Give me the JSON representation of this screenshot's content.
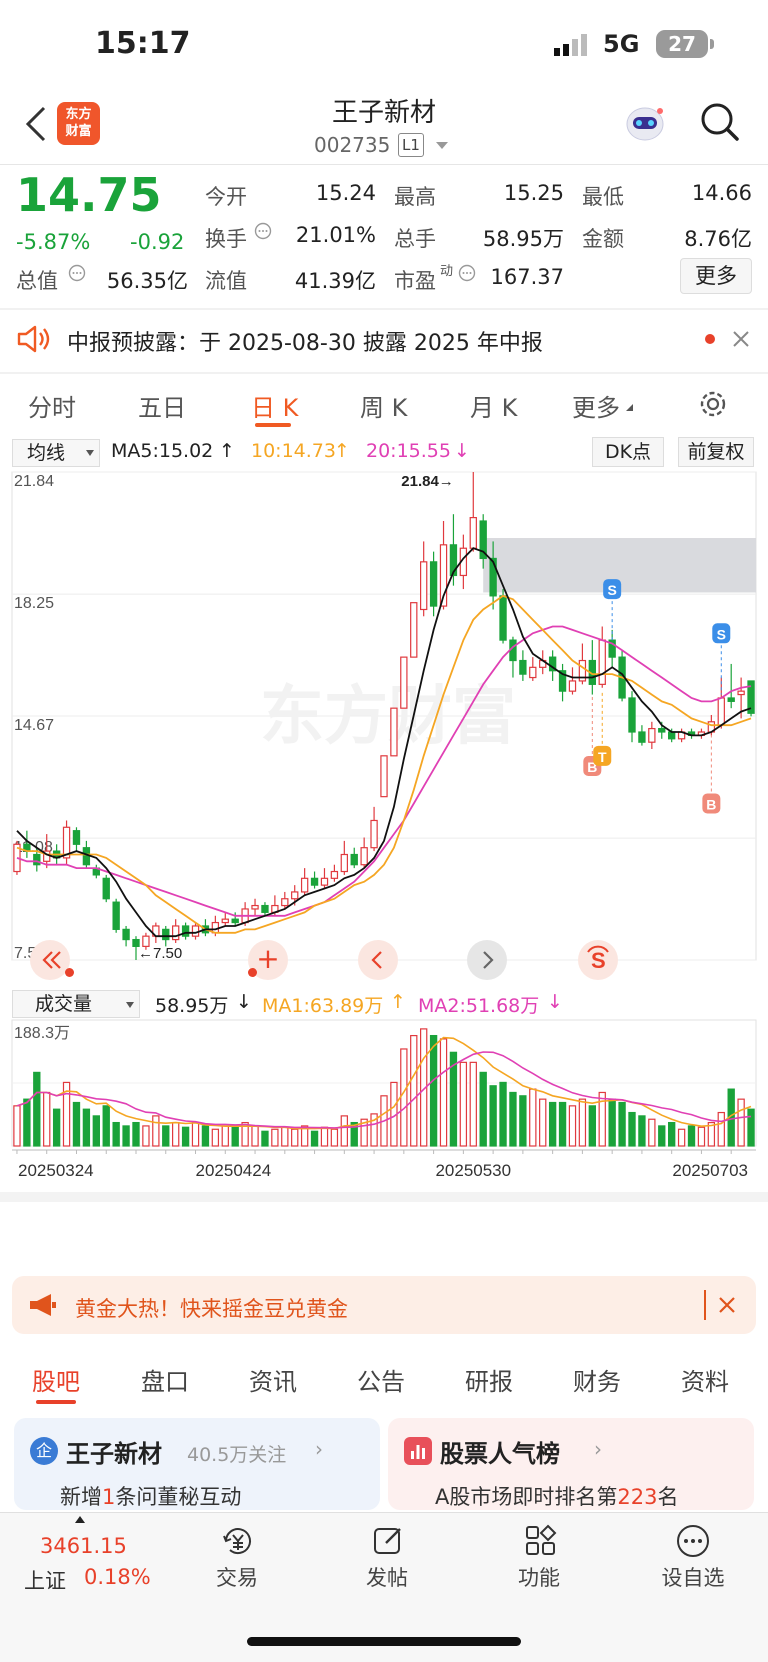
{
  "status_bar": {
    "time": "15:17",
    "network": "5G",
    "battery": "27"
  },
  "header": {
    "back_icon": "chevron-left-icon",
    "app_logo_text": "东方\n财富",
    "title": "王子新材",
    "code": "002735",
    "level_badge": "L1"
  },
  "quote": {
    "price": "14.75",
    "change_pct": "-5.87%",
    "change": "-0.92",
    "fields": [
      {
        "label": "今开",
        "value": "15.24"
      },
      {
        "label": "最高",
        "value": "15.25"
      },
      {
        "label": "最低",
        "value": "14.66"
      },
      {
        "label": "换手",
        "value": "21.01%"
      },
      {
        "label": "总手",
        "value": "58.95万"
      },
      {
        "label": "金额",
        "value": "8.76亿"
      },
      {
        "label": "总值",
        "value": "56.35亿"
      },
      {
        "label": "流值",
        "value": "41.39亿"
      },
      {
        "label": "市盈",
        "value": "167.37"
      }
    ],
    "pe_superscript": "动",
    "more_button": "更多"
  },
  "notice": {
    "text": "中报预披露：于 2025-08-30 披露 2025 年中报"
  },
  "period_tabs": [
    "分时",
    "五日",
    "日 K",
    "周 K",
    "月 K",
    "更多"
  ],
  "period_active_index": 2,
  "ma_bar": {
    "select_label": "均线",
    "ma5": "MA5:15.02",
    "ma10": "10:14.73",
    "ma20": "20:15.55",
    "dk_button": "DK点",
    "adjust_button": "前复权"
  },
  "chart_controls": {
    "zoom_in": "+"
  },
  "volume_bar": {
    "select_label": "成交量",
    "vol": "58.95万",
    "ma1": "MA1:63.89万",
    "ma2": "MA2:51.68万"
  },
  "colors": {
    "up": "#e0393e",
    "down": "#1aa33a",
    "ma5": "#111111",
    "ma10": "#f5a623",
    "ma20": "#e040b4",
    "accent": "#f05a23"
  },
  "chart_data": {
    "type": "candlestick",
    "y_ticks": [
      "21.84",
      "18.25",
      "14.67",
      "11.08",
      "7.50"
    ],
    "ylim": [
      7.5,
      21.84
    ],
    "annotations": {
      "max": "21.84",
      "min": "7.50",
      "signals": [
        "S",
        "S",
        "B",
        "T",
        "B"
      ]
    },
    "watermark": "东方财富",
    "x_ticks": [
      "20250324",
      "20250424",
      "20250530",
      "20250703"
    ],
    "volume_max_label": "188.3万",
    "candles": [
      [
        10.1,
        10.9,
        11.0,
        10.0
      ],
      [
        10.9,
        10.7,
        11.3,
        10.5
      ],
      [
        10.6,
        10.3,
        10.8,
        10.1
      ],
      [
        10.4,
        10.7,
        11.2,
        10.2
      ],
      [
        10.7,
        10.5,
        10.9,
        10.3
      ],
      [
        10.5,
        11.4,
        11.6,
        10.3
      ],
      [
        11.3,
        10.9,
        11.4,
        10.7
      ],
      [
        10.8,
        10.3,
        11.0,
        10.2
      ],
      [
        10.2,
        10.0,
        10.3,
        9.9
      ],
      [
        9.9,
        9.3,
        10.0,
        9.2
      ],
      [
        9.2,
        8.4,
        9.3,
        8.3
      ],
      [
        8.4,
        8.1,
        8.5,
        7.9
      ],
      [
        8.1,
        7.9,
        8.2,
        7.5
      ],
      [
        7.9,
        8.2,
        8.3,
        7.8
      ],
      [
        8.2,
        8.5,
        8.6,
        8.0
      ],
      [
        8.4,
        8.1,
        8.5,
        7.9
      ],
      [
        8.1,
        8.5,
        8.7,
        8.0
      ],
      [
        8.5,
        8.2,
        8.6,
        8.1
      ],
      [
        8.2,
        8.5,
        8.6,
        8.1
      ],
      [
        8.5,
        8.3,
        8.7,
        8.2
      ],
      [
        8.3,
        8.6,
        8.8,
        8.2
      ],
      [
        8.6,
        8.7,
        8.9,
        8.5
      ],
      [
        8.7,
        8.6,
        8.9,
        8.5
      ],
      [
        8.6,
        9.0,
        9.2,
        8.5
      ],
      [
        9.0,
        9.1,
        9.3,
        8.8
      ],
      [
        9.1,
        8.9,
        9.2,
        8.8
      ],
      [
        8.9,
        9.1,
        9.4,
        8.8
      ],
      [
        9.1,
        9.3,
        9.5,
        9.0
      ],
      [
        9.3,
        9.5,
        9.7,
        9.1
      ],
      [
        9.5,
        9.9,
        10.2,
        9.4
      ],
      [
        9.9,
        9.7,
        10.1,
        9.6
      ],
      [
        9.7,
        9.9,
        10.2,
        9.6
      ],
      [
        9.9,
        10.1,
        10.3,
        9.8
      ],
      [
        10.1,
        10.6,
        11.0,
        10.0
      ],
      [
        10.6,
        10.3,
        10.8,
        10.2
      ],
      [
        10.3,
        10.8,
        11.1,
        10.2
      ],
      [
        10.8,
        11.6,
        12.0,
        10.7
      ],
      [
        12.3,
        13.5,
        13.5,
        12.3
      ],
      [
        13.5,
        14.9,
        14.9,
        13.5
      ],
      [
        14.9,
        16.4,
        16.4,
        14.9
      ],
      [
        16.4,
        18.0,
        18.0,
        16.4
      ],
      [
        17.8,
        19.2,
        19.8,
        17.6
      ],
      [
        19.2,
        17.9,
        19.5,
        17.6
      ],
      [
        17.9,
        19.7,
        20.4,
        17.8
      ],
      [
        19.7,
        18.8,
        20.6,
        18.5
      ],
      [
        18.8,
        19.6,
        20.0,
        18.4
      ],
      [
        19.6,
        20.5,
        21.84,
        19.5
      ],
      [
        20.4,
        19.3,
        20.6,
        19.0
      ],
      [
        19.3,
        18.2,
        19.8,
        17.8
      ],
      [
        18.2,
        16.9,
        18.4,
        16.8
      ],
      [
        16.9,
        16.3,
        17.0,
        15.8
      ],
      [
        16.3,
        15.9,
        16.6,
        15.7
      ],
      [
        15.8,
        16.1,
        16.4,
        15.7
      ],
      [
        16.1,
        16.3,
        16.6,
        15.9
      ],
      [
        16.4,
        16.0,
        16.6,
        15.7
      ],
      [
        16.0,
        15.4,
        16.2,
        15.1
      ],
      [
        15.4,
        15.7,
        16.1,
        15.3
      ],
      [
        15.7,
        16.3,
        16.8,
        15.6
      ],
      [
        16.3,
        15.6,
        16.9,
        15.3
      ],
      [
        15.6,
        16.9,
        17.3,
        15.5
      ],
      [
        16.9,
        16.4,
        17.2,
        16.1
      ],
      [
        16.4,
        15.2,
        16.6,
        15.1
      ],
      [
        15.2,
        14.2,
        15.4,
        13.9
      ],
      [
        14.2,
        13.9,
        14.4,
        13.8
      ],
      [
        13.9,
        14.3,
        14.5,
        13.7
      ],
      [
        14.3,
        14.2,
        14.5,
        14.0
      ],
      [
        14.2,
        14.0,
        14.3,
        13.9
      ],
      [
        14.0,
        14.2,
        14.3,
        13.9
      ],
      [
        14.2,
        14.1,
        14.3,
        14.0
      ],
      [
        14.1,
        14.2,
        14.3,
        14.0
      ],
      [
        14.2,
        14.5,
        14.7,
        14.1
      ],
      [
        14.4,
        15.2,
        15.8,
        14.3
      ],
      [
        15.2,
        15.1,
        16.2,
        14.9
      ],
      [
        15.3,
        15.4,
        15.8,
        14.6
      ],
      [
        15.7,
        14.75,
        15.25,
        14.66
      ]
    ],
    "volumes": [
      60,
      70,
      110,
      80,
      55,
      95,
      65,
      55,
      45,
      60,
      35,
      30,
      35,
      30,
      45,
      30,
      35,
      28,
      35,
      30,
      25,
      30,
      28,
      35,
      30,
      22,
      25,
      28,
      25,
      30,
      22,
      28,
      25,
      45,
      35,
      40,
      48,
      75,
      95,
      145,
      165,
      175,
      165,
      160,
      140,
      125,
      125,
      110,
      90,
      95,
      80,
      75,
      85,
      70,
      65,
      65,
      60,
      70,
      60,
      80,
      70,
      65,
      50,
      45,
      40,
      30,
      35,
      25,
      30,
      28,
      35,
      50,
      85,
      70,
      55
    ],
    "ma5": [
      11.3,
      11.0,
      10.8,
      10.6,
      10.5,
      10.6,
      10.7,
      10.6,
      10.5,
      10.2,
      9.8,
      9.3,
      8.9,
      8.5,
      8.2,
      8.2,
      8.2,
      8.3,
      8.3,
      8.4,
      8.4,
      8.5,
      8.5,
      8.6,
      8.7,
      8.8,
      8.9,
      9.0,
      9.2,
      9.4,
      9.5,
      9.6,
      9.7,
      9.9,
      10.0,
      10.2,
      10.5,
      11.0,
      12.0,
      13.4,
      14.7,
      16.0,
      17.2,
      18.2,
      18.9,
      19.3,
      19.6,
      19.5,
      19.2,
      18.5,
      17.8,
      17.0,
      16.5,
      16.3,
      16.1,
      15.9,
      15.8,
      15.8,
      15.8,
      15.9,
      16.1,
      15.9,
      15.5,
      15.1,
      14.8,
      14.4,
      14.2,
      14.2,
      14.1,
      14.1,
      14.2,
      14.4,
      14.6,
      14.8,
      14.9
    ],
    "ma10": [
      10.8,
      10.7,
      10.7,
      10.6,
      10.6,
      10.6,
      10.6,
      10.6,
      10.6,
      10.5,
      10.3,
      10.1,
      9.9,
      9.7,
      9.4,
      9.2,
      9.0,
      8.8,
      8.6,
      8.4,
      8.3,
      8.3,
      8.3,
      8.4,
      8.4,
      8.5,
      8.6,
      8.7,
      8.8,
      8.9,
      9.1,
      9.2,
      9.3,
      9.5,
      9.7,
      9.8,
      10.0,
      10.3,
      10.8,
      11.6,
      12.5,
      13.5,
      14.4,
      15.3,
      16.1,
      16.9,
      17.5,
      17.8,
      18.0,
      18.2,
      18.1,
      17.8,
      17.5,
      17.2,
      16.9,
      16.6,
      16.3,
      16.1,
      15.9,
      15.9,
      15.9,
      15.8,
      15.7,
      15.5,
      15.3,
      15.1,
      15.0,
      14.8,
      14.6,
      14.5,
      14.4,
      14.4,
      14.4,
      14.5,
      14.6
    ],
    "ma20": [
      10.5,
      10.4,
      10.4,
      10.3,
      10.3,
      10.3,
      10.2,
      10.2,
      10.2,
      10.1,
      10.0,
      9.9,
      9.8,
      9.7,
      9.6,
      9.5,
      9.4,
      9.3,
      9.2,
      9.1,
      9.0,
      8.9,
      8.8,
      8.8,
      8.8,
      8.8,
      8.8,
      8.8,
      8.9,
      9.0,
      9.1,
      9.2,
      9.4,
      9.6,
      9.8,
      10.1,
      10.4,
      10.8,
      11.2,
      11.6,
      12.1,
      12.6,
      13.1,
      13.6,
      14.1,
      14.6,
      15.1,
      15.6,
      16.0,
      16.4,
      16.7,
      16.9,
      17.1,
      17.2,
      17.3,
      17.3,
      17.2,
      17.1,
      17.0,
      16.9,
      16.8,
      16.6,
      16.4,
      16.2,
      16.0,
      15.8,
      15.6,
      15.4,
      15.2,
      15.1,
      15.1,
      15.2,
      15.4,
      15.5,
      15.55
    ]
  },
  "banner": {
    "text": "黄金大热！快来摇金豆兑黄金"
  },
  "bottom_tabs": [
    "股吧",
    "盘口",
    "资讯",
    "公告",
    "研报",
    "财务",
    "资料"
  ],
  "bottom_active_index": 0,
  "card_left": {
    "badge": "企",
    "title": "王子新材",
    "followers": "40.5万关注",
    "sub_prefix": "新增",
    "sub_num": "1",
    "sub_suffix": "条问董秘互动"
  },
  "card_right": {
    "title": "股票人气榜",
    "sub_prefix": "A股市场即时排名第",
    "sub_num": "223",
    "sub_suffix": "名"
  },
  "nav": {
    "index_value": "3461.15",
    "index_name": "上证",
    "index_change": "0.18%",
    "items": [
      "交易",
      "发帖",
      "功能",
      "设自选"
    ]
  }
}
